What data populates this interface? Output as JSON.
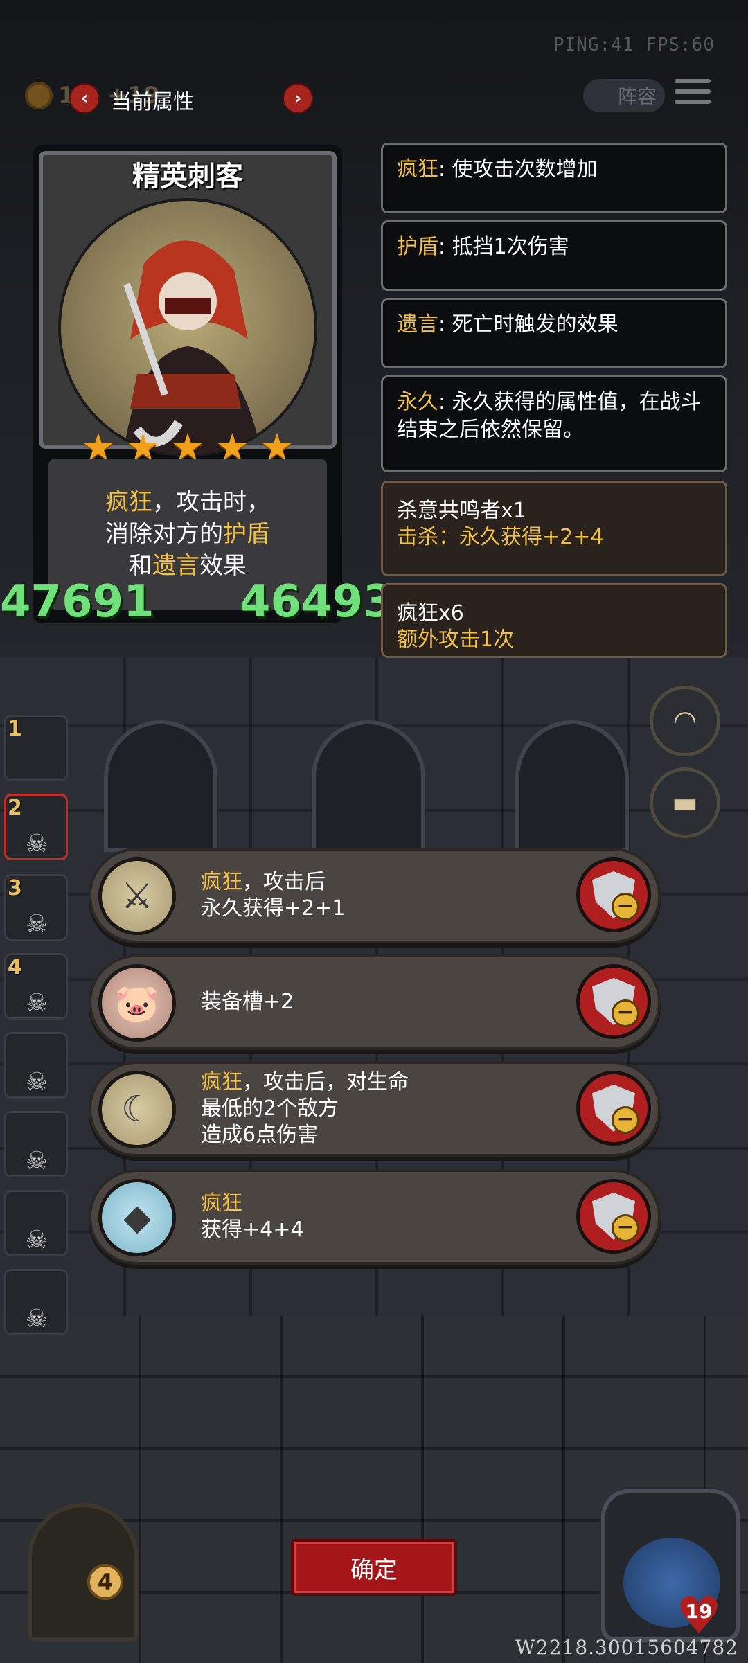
{
  "hud": {
    "ping": "PING:41   FPS:60",
    "gold": "1  3 +19",
    "section_title": "当前属性",
    "prev": "‹",
    "next": "›",
    "lineup": "阵容"
  },
  "hero": {
    "name": "精英刺客",
    "stars": 5,
    "desc": {
      "l1_key": "疯狂",
      "l1_rest": "，攻击时，",
      "l2_a": "消除对方的",
      "l2_key": "护盾",
      "l3_a": "和",
      "l3_key": "遗言",
      "l3_rest": "效果"
    },
    "attack": "47691",
    "health": "46493"
  },
  "keywords": [
    {
      "key": "疯狂",
      "text": ": 使攻击次数增加"
    },
    {
      "key": "护盾",
      "text": ": 抵挡1次伤害"
    },
    {
      "key": "遗言",
      "text": ": 死亡时触发的效果"
    },
    {
      "key": "永久",
      "text": ": 永久获得的属性值，在战斗结束之后依然保留。"
    }
  ],
  "buffs": [
    {
      "title": "杀意共鸣者x1",
      "sub": "击杀：永久获得+2+4"
    },
    {
      "title": "疯狂x6",
      "sub": "额外攻击1次"
    }
  ],
  "team_slots": [
    "1",
    "2",
    "3",
    "4"
  ],
  "skills": [
    {
      "icon": "crossed-swords-icon",
      "key": "疯狂",
      "l1_rest": "，攻击后",
      "l2": "永久获得+2+1",
      "l3": ""
    },
    {
      "icon": "pig-icon",
      "key": "",
      "l1_rest": "装备槽+2",
      "l2": "",
      "l3": ""
    },
    {
      "icon": "axe-icon",
      "key": "疯狂",
      "l1_rest": "，攻击后，对生命",
      "l2": "最低的2个敌方",
      "l3": "造成6点伤害"
    },
    {
      "icon": "crystal-icon",
      "key": "疯狂",
      "l1_rest": "",
      "l2": "获得+4+4",
      "l3": ""
    }
  ],
  "confirm": "确定",
  "chest_count": "4",
  "lives": "19",
  "build_id": "W2218.30015604782"
}
